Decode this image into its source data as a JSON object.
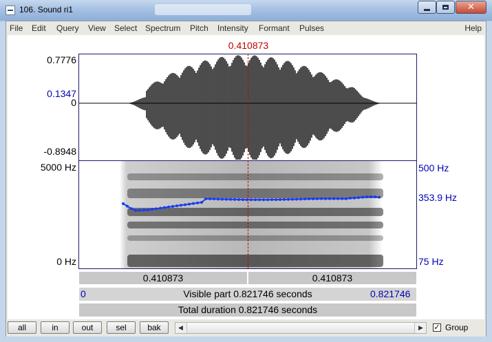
{
  "window": {
    "title": "106. Sound ri1",
    "close_glyph": "✕"
  },
  "menu": {
    "items": [
      "File",
      "Edit",
      "Query",
      "View",
      "Select",
      "Spectrum",
      "Pitch",
      "Intensity",
      "Formant",
      "Pulses"
    ],
    "help": "Help"
  },
  "editor": {
    "cursor_time": "0.410873",
    "wave_max": "0.7776",
    "wave_mid_blue": "0.1347",
    "wave_zero": "0",
    "wave_min": "-0.8948",
    "spec_top": "5000 Hz",
    "spec_bottom": "0 Hz",
    "pitch_top": "500 Hz",
    "pitch_cursor": "353.9 Hz",
    "pitch_bottom": "75 Hz",
    "seg_left": "0.410873",
    "seg_right": "0.410873",
    "visible_start": "0",
    "visible_part": "Visible part 0.821746 seconds",
    "visible_end": "0.821746",
    "total_duration": "Total duration 0.821746 seconds"
  },
  "toolbar": {
    "all": "all",
    "in": "in",
    "out": "out",
    "sel": "sel",
    "bak": "bak",
    "scroll_left": "◀",
    "scroll_right": "▶",
    "group_check": "✓",
    "group_label": "Group"
  },
  "colors": {
    "cursor": "#c00000",
    "pitch": "#0000b4",
    "pitch_curve": "#1a3cf0"
  },
  "icons": [
    "window-app-icon",
    "minimize-icon",
    "maximize-icon",
    "close-icon",
    "scroll-left-arrow-icon",
    "scroll-right-arrow-icon",
    "checkbox-icon"
  ]
}
